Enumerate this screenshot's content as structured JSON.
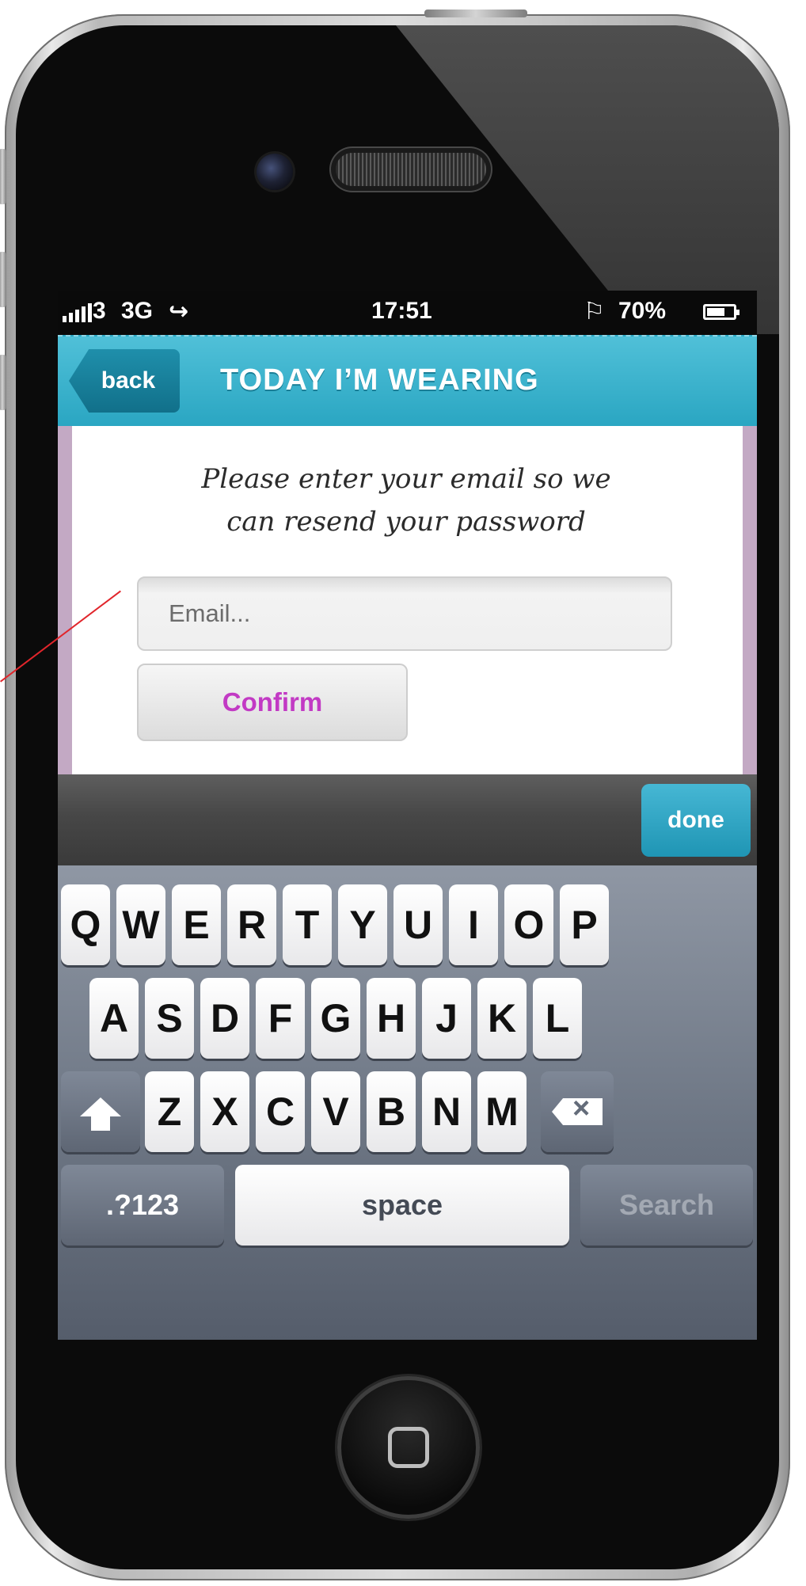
{
  "status_bar": {
    "carrier": "3",
    "network": "3G",
    "time": "17:51",
    "battery": "70%"
  },
  "header": {
    "back_label": "back",
    "title": "TODAY I’M WEARING"
  },
  "content": {
    "instruction_line1": "Please enter your email so we",
    "instruction_line2": "can resend your password",
    "email_placeholder": "Email...",
    "confirm_label": "Confirm"
  },
  "accessory": {
    "done_label": "done"
  },
  "keyboard": {
    "row1": [
      "Q",
      "W",
      "E",
      "R",
      "T",
      "Y",
      "U",
      "I",
      "O",
      "P"
    ],
    "row2": [
      "A",
      "S",
      "D",
      "F",
      "G",
      "H",
      "J",
      "K",
      "L"
    ],
    "row3": [
      "Z",
      "X",
      "C",
      "V",
      "B",
      "N",
      "M"
    ],
    "numbers_label": ".?123",
    "space_label": "space",
    "search_label": "Search"
  },
  "colors": {
    "header": "#2aa6c2",
    "confirm_text": "#c23ac4",
    "annotation_line": "#e1252b"
  }
}
